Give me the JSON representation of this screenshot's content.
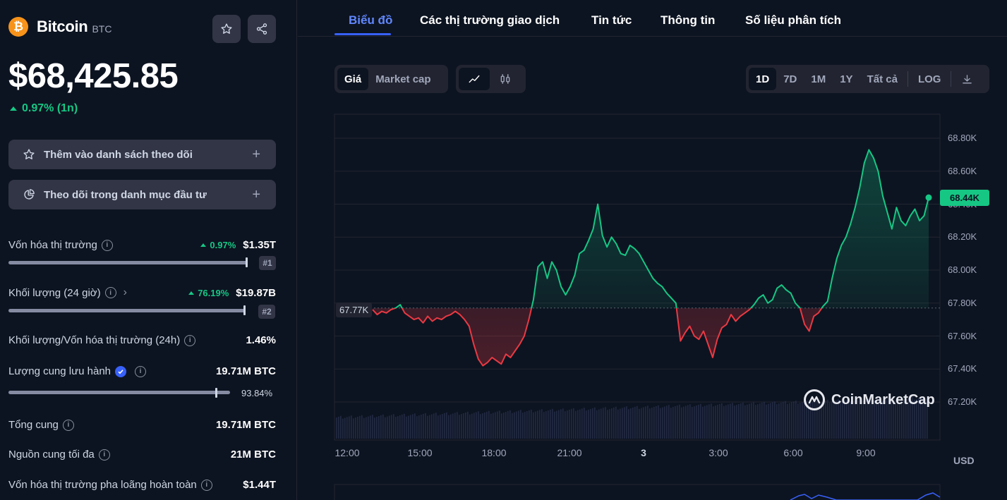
{
  "coin": {
    "name": "Bitcoin",
    "symbol": "BTC",
    "logo_glyph": "₿",
    "price": "$68,425.85",
    "change": "0.97% (1n)"
  },
  "actions": {
    "watchlist_label": "Thêm vào danh sách theo dõi",
    "portfolio_label": "Theo dõi trong danh mục đầu tư",
    "plus": "+"
  },
  "stats": {
    "market_cap": {
      "label": "Vốn hóa thị trường",
      "pct": "0.97%",
      "value": "$1.35T",
      "rank": "#1",
      "bar_fill": 0.99
    },
    "volume": {
      "label": "Khối lượng (24 giờ)",
      "pct": "76.19%",
      "value": "$19.87B",
      "rank": "#2",
      "bar_fill": 0.98
    },
    "vol_mcap": {
      "label": "Khối lượng/Vốn hóa thị trường (24h)",
      "value": "1.46%"
    },
    "circulating": {
      "label": "Lượng cung lưu hành",
      "value": "19.71M BTC",
      "pct": "93.84%",
      "bar_fill": 0.9384
    },
    "total_supply": {
      "label": "Tổng cung",
      "value": "19.71M BTC"
    },
    "max_supply": {
      "label": "Nguồn cung tối đa",
      "value": "21M BTC"
    },
    "fdv": {
      "label": "Vốn hóa thị trường pha loãng hoàn toàn",
      "value": "$1.44T"
    }
  },
  "tabs": [
    "Biểu đồ",
    "Các thị trường giao dịch",
    "Tin tức",
    "Thông tin",
    "Số liệu phân tích"
  ],
  "controls": {
    "price_label": "Giá",
    "mcap_label": "Market cap",
    "ranges": [
      "1D",
      "7D",
      "1M",
      "1Y",
      "Tất cả"
    ],
    "log_label": "LOG"
  },
  "chart_data": {
    "type": "line",
    "x_ticks": [
      "12:00",
      "15:00",
      "18:00",
      "21:00",
      "3",
      "3:00",
      "6:00",
      "9:00"
    ],
    "y_ticks": [
      "68.80K",
      "68.60K",
      "68.40K",
      "68.20K",
      "68.00K",
      "67.80K",
      "67.60K",
      "67.40K",
      "67.20K"
    ],
    "ylim": [
      67.2,
      68.8
    ],
    "baseline_label": "67.77K",
    "baseline": 67.77,
    "current_label": "68.44K",
    "unit": "USD",
    "watermark": "CoinMarketCap",
    "colors": {
      "up": "#16c784",
      "down": "#ea3943"
    },
    "series": [
      {
        "values": [
          67.76,
          67.73,
          67.75,
          67.74,
          67.76,
          67.77,
          67.79,
          67.74,
          67.72,
          67.7,
          67.71,
          67.68,
          67.72,
          67.69,
          67.71,
          67.7,
          67.72,
          67.73,
          67.75,
          67.73,
          67.7,
          67.66,
          67.55,
          67.46,
          67.42,
          67.44,
          67.47,
          67.45,
          67.43,
          67.49,
          67.47,
          67.51,
          67.55,
          67.6,
          67.7,
          67.82,
          68.02,
          68.05,
          67.95,
          68.05,
          68.0,
          67.9,
          67.85,
          67.9,
          67.97,
          68.1,
          68.12,
          68.18,
          68.25,
          68.4,
          68.21,
          68.14,
          68.2,
          68.16,
          68.1,
          68.09,
          68.15,
          68.13,
          68.1,
          68.05,
          68.0,
          67.95,
          67.92,
          67.9,
          67.86,
          67.83,
          67.8,
          67.57,
          67.62,
          67.66,
          67.6,
          67.58,
          67.63,
          67.55,
          67.47,
          67.58,
          67.65,
          67.67,
          67.73,
          67.69,
          67.72,
          67.74,
          67.76,
          67.79,
          67.83,
          67.85,
          67.8,
          67.82,
          67.89,
          67.91,
          67.88,
          67.86,
          67.8,
          67.77,
          67.67,
          67.63,
          67.72,
          67.74,
          67.78,
          67.81,
          67.95,
          68.07,
          68.15,
          68.2,
          68.28,
          68.38,
          68.5,
          68.65,
          68.73,
          68.68,
          68.6,
          68.45,
          68.35,
          68.25,
          68.38,
          68.3,
          68.27,
          68.33,
          68.37,
          68.3,
          68.33,
          68.44
        ]
      }
    ]
  }
}
